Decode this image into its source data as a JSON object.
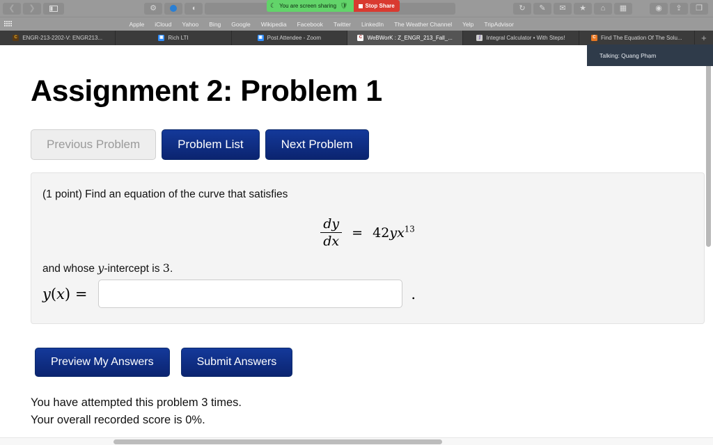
{
  "browser": {
    "toolbar": {
      "back_icon": "chevron-left-icon",
      "forward_icon": "chevron-right-icon",
      "sidebar_icon": "sidebar-toggle-icon",
      "extensions_icon": "gear-icon",
      "globe_icon": "globe-icon",
      "contrast_icon": "contrast-icon",
      "reload_icon": "reload-icon",
      "edit_icon": "markup-icon",
      "mail_icon": "mail-icon",
      "reader_icon": "reader-icon",
      "home_icon": "home-icon",
      "apps_icon": "apps-grid-icon",
      "download_icon": "download-icon",
      "share_icon": "share-icon",
      "tabs_icon": "tab-overview-icon",
      "url_value": ""
    },
    "screen_share": {
      "status_text": "You are screen sharing",
      "shield_icon": "shield-icon",
      "leaf_icon": "zoom-leaf-icon",
      "stop_label": "Stop Share"
    },
    "bookmarks": {
      "grid_icon": "bookmarks-grid-icon",
      "links": [
        "Apple",
        "iCloud",
        "Yahoo",
        "Bing",
        "Google",
        "Wikipedia",
        "Facebook",
        "Twitter",
        "LinkedIn",
        "The Weather Channel",
        "Yelp",
        "TripAdvisor"
      ]
    },
    "tabs": [
      {
        "label": "ENGR-213-2202-V: ENGR213...",
        "icon": "canvas-favicon",
        "active": false
      },
      {
        "label": "Rich LTI",
        "icon": "zoom-favicon",
        "active": false
      },
      {
        "label": "Post Attendee - Zoom",
        "icon": "zoom-favicon",
        "active": false
      },
      {
        "label": "WeBWorK : Z_ENGR_213_Fall_...",
        "icon": "webwork-favicon",
        "active": true
      },
      {
        "label": "Integral Calculator • With Steps!",
        "icon": "integral-favicon",
        "active": false
      },
      {
        "label": "Find The Equation Of The Solu...",
        "icon": "chegg-favicon",
        "active": false
      }
    ],
    "new_tab_label": "+"
  },
  "toast": {
    "text": "Talking: Quang Phạm"
  },
  "page": {
    "title": "Assignment 2: Problem 1",
    "nav_buttons": [
      {
        "label": "Previous Problem",
        "disabled": true
      },
      {
        "label": "Problem List",
        "disabled": false
      },
      {
        "label": "Next Problem",
        "disabled": false
      }
    ],
    "problem": {
      "points_text": "(1 point) Find an equation of the curve that satisfies",
      "equation": {
        "numerator": "dy",
        "denominator": "dx",
        "equals": "=",
        "coefficient": "42",
        "var1": "y",
        "var2": "x",
        "exponent": "13",
        "plain": "dy/dx = 42yx^13"
      },
      "condition_prefix": "and whose ",
      "condition_var": "y",
      "condition_suffix": "-intercept is ",
      "condition_value": "3",
      "condition_period": ".",
      "answer_label_fn": "y",
      "answer_label_open": "(",
      "answer_label_arg": "x",
      "answer_label_close": ")",
      "answer_label_eq": "=",
      "answer_value": "",
      "answer_placeholder": "",
      "trailing_period": "."
    },
    "submit_buttons": [
      {
        "label": "Preview My Answers"
      },
      {
        "label": "Submit Answers"
      }
    ],
    "footer": {
      "attempts_text": "You have attempted this problem 3 times.",
      "score_text": "Your overall recorded score is 0%."
    }
  },
  "colors": {
    "button_blue": "#14399a",
    "button_blue_dark": "#0b2470",
    "share_green": "#62d46a",
    "share_red": "#d93a30",
    "problem_bg": "#f4f4f4",
    "toast_bg": "#2f3b4a"
  }
}
